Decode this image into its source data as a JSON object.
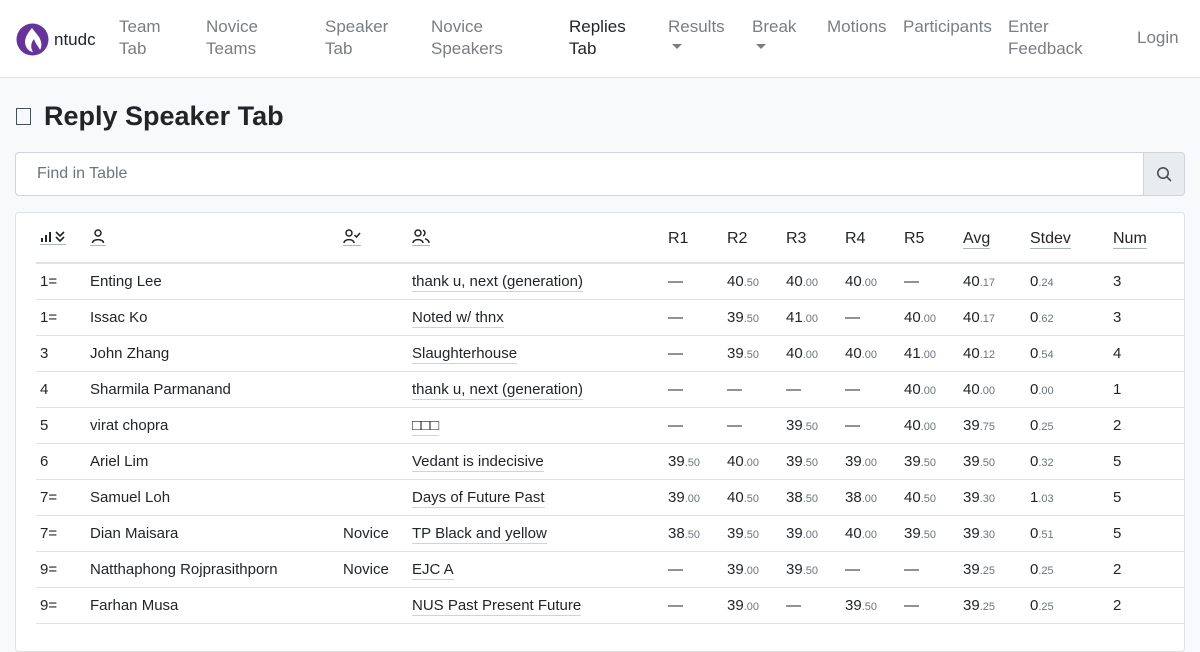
{
  "nav": {
    "brand": "ntudc",
    "items": [
      {
        "label": "Team Tab",
        "active": false
      },
      {
        "label": "Novice Teams",
        "active": false
      },
      {
        "label": "Speaker Tab",
        "active": false
      },
      {
        "label": "Novice Speakers",
        "active": false
      },
      {
        "label": "Replies Tab",
        "active": true
      },
      {
        "label": "Results",
        "active": false
      },
      {
        "label": "Break",
        "active": false
      },
      {
        "label": "Motions",
        "active": false
      },
      {
        "label": "Participants",
        "active": false
      },
      {
        "label": "Enter Feedback",
        "active": false
      }
    ],
    "login": "Login"
  },
  "page": {
    "title": "Reply Speaker Tab"
  },
  "search": {
    "placeholder": "Find in Table"
  },
  "table": {
    "headers": {
      "r1": "R1",
      "r2": "R2",
      "r3": "R3",
      "r4": "R4",
      "r5": "R5",
      "avg": "Avg",
      "stdev": "Stdev",
      "num": "Num"
    },
    "rows": [
      {
        "rank": "1=",
        "name": "Enting Lee",
        "category": "",
        "team": "thank u, next (generation)",
        "r1": {
          "i": "—",
          "d": ""
        },
        "r2": {
          "i": "40",
          "d": ".50"
        },
        "r3": {
          "i": "40",
          "d": ".00"
        },
        "r4": {
          "i": "40",
          "d": ".00"
        },
        "r5": {
          "i": "—",
          "d": ""
        },
        "avg": {
          "i": "40",
          "d": ".17"
        },
        "stdev": {
          "i": "0",
          "d": ".24"
        },
        "num": "3"
      },
      {
        "rank": "1=",
        "name": "Issac Ko",
        "category": "",
        "team": "Noted w/ thnx",
        "r1": {
          "i": "—",
          "d": ""
        },
        "r2": {
          "i": "39",
          "d": ".50"
        },
        "r3": {
          "i": "41",
          "d": ".00"
        },
        "r4": {
          "i": "—",
          "d": ""
        },
        "r5": {
          "i": "40",
          "d": ".00"
        },
        "avg": {
          "i": "40",
          "d": ".17"
        },
        "stdev": {
          "i": "0",
          "d": ".62"
        },
        "num": "3"
      },
      {
        "rank": "3",
        "name": "John Zhang",
        "category": "",
        "team": "Slaughterhouse",
        "r1": {
          "i": "—",
          "d": ""
        },
        "r2": {
          "i": "39",
          "d": ".50"
        },
        "r3": {
          "i": "40",
          "d": ".00"
        },
        "r4": {
          "i": "40",
          "d": ".00"
        },
        "r5": {
          "i": "41",
          "d": ".00"
        },
        "avg": {
          "i": "40",
          "d": ".12"
        },
        "stdev": {
          "i": "0",
          "d": ".54"
        },
        "num": "4"
      },
      {
        "rank": "4",
        "name": "Sharmila Parmanand",
        "category": "",
        "team": "thank u, next (generation)",
        "r1": {
          "i": "—",
          "d": ""
        },
        "r2": {
          "i": "—",
          "d": ""
        },
        "r3": {
          "i": "—",
          "d": ""
        },
        "r4": {
          "i": "—",
          "d": ""
        },
        "r5": {
          "i": "40",
          "d": ".00"
        },
        "avg": {
          "i": "40",
          "d": ".00"
        },
        "stdev": {
          "i": "0",
          "d": ".00"
        },
        "num": "1"
      },
      {
        "rank": "5",
        "name": "virat chopra",
        "category": "",
        "team": "□□□",
        "r1": {
          "i": "—",
          "d": ""
        },
        "r2": {
          "i": "—",
          "d": ""
        },
        "r3": {
          "i": "39",
          "d": ".50"
        },
        "r4": {
          "i": "—",
          "d": ""
        },
        "r5": {
          "i": "40",
          "d": ".00"
        },
        "avg": {
          "i": "39",
          "d": ".75"
        },
        "stdev": {
          "i": "0",
          "d": ".25"
        },
        "num": "2"
      },
      {
        "rank": "6",
        "name": "Ariel Lim",
        "category": "",
        "team": "Vedant is indecisive",
        "r1": {
          "i": "39",
          "d": ".50"
        },
        "r2": {
          "i": "40",
          "d": ".00"
        },
        "r3": {
          "i": "39",
          "d": ".50"
        },
        "r4": {
          "i": "39",
          "d": ".00"
        },
        "r5": {
          "i": "39",
          "d": ".50"
        },
        "avg": {
          "i": "39",
          "d": ".50"
        },
        "stdev": {
          "i": "0",
          "d": ".32"
        },
        "num": "5"
      },
      {
        "rank": "7=",
        "name": "Samuel Loh",
        "category": "",
        "team": "Days of Future Past",
        "r1": {
          "i": "39",
          "d": ".00"
        },
        "r2": {
          "i": "40",
          "d": ".50"
        },
        "r3": {
          "i": "38",
          "d": ".50"
        },
        "r4": {
          "i": "38",
          "d": ".00"
        },
        "r5": {
          "i": "40",
          "d": ".50"
        },
        "avg": {
          "i": "39",
          "d": ".30"
        },
        "stdev": {
          "i": "1",
          "d": ".03"
        },
        "num": "5"
      },
      {
        "rank": "7=",
        "name": "Dian Maisara",
        "category": "Novice",
        "team": "TP Black and yellow",
        "r1": {
          "i": "38",
          "d": ".50"
        },
        "r2": {
          "i": "39",
          "d": ".50"
        },
        "r3": {
          "i": "39",
          "d": ".00"
        },
        "r4": {
          "i": "40",
          "d": ".00"
        },
        "r5": {
          "i": "39",
          "d": ".50"
        },
        "avg": {
          "i": "39",
          "d": ".30"
        },
        "stdev": {
          "i": "0",
          "d": ".51"
        },
        "num": "5"
      },
      {
        "rank": "9=",
        "name": "Natthaphong Rojprasithporn",
        "category": "Novice",
        "team": "EJC A",
        "r1": {
          "i": "—",
          "d": ""
        },
        "r2": {
          "i": "39",
          "d": ".00"
        },
        "r3": {
          "i": "39",
          "d": ".50"
        },
        "r4": {
          "i": "—",
          "d": ""
        },
        "r5": {
          "i": "—",
          "d": ""
        },
        "avg": {
          "i": "39",
          "d": ".25"
        },
        "stdev": {
          "i": "0",
          "d": ".25"
        },
        "num": "2"
      },
      {
        "rank": "9=",
        "name": "Farhan Musa",
        "category": "",
        "team": "NUS Past Present Future",
        "r1": {
          "i": "—",
          "d": ""
        },
        "r2": {
          "i": "39",
          "d": ".00"
        },
        "r3": {
          "i": "—",
          "d": ""
        },
        "r4": {
          "i": "39",
          "d": ".50"
        },
        "r5": {
          "i": "—",
          "d": ""
        },
        "avg": {
          "i": "39",
          "d": ".25"
        },
        "stdev": {
          "i": "0",
          "d": ".25"
        },
        "num": "2"
      }
    ]
  },
  "colors": {
    "brand": "#663399",
    "nav_text": "#7a7e82",
    "active_text": "#212529"
  }
}
